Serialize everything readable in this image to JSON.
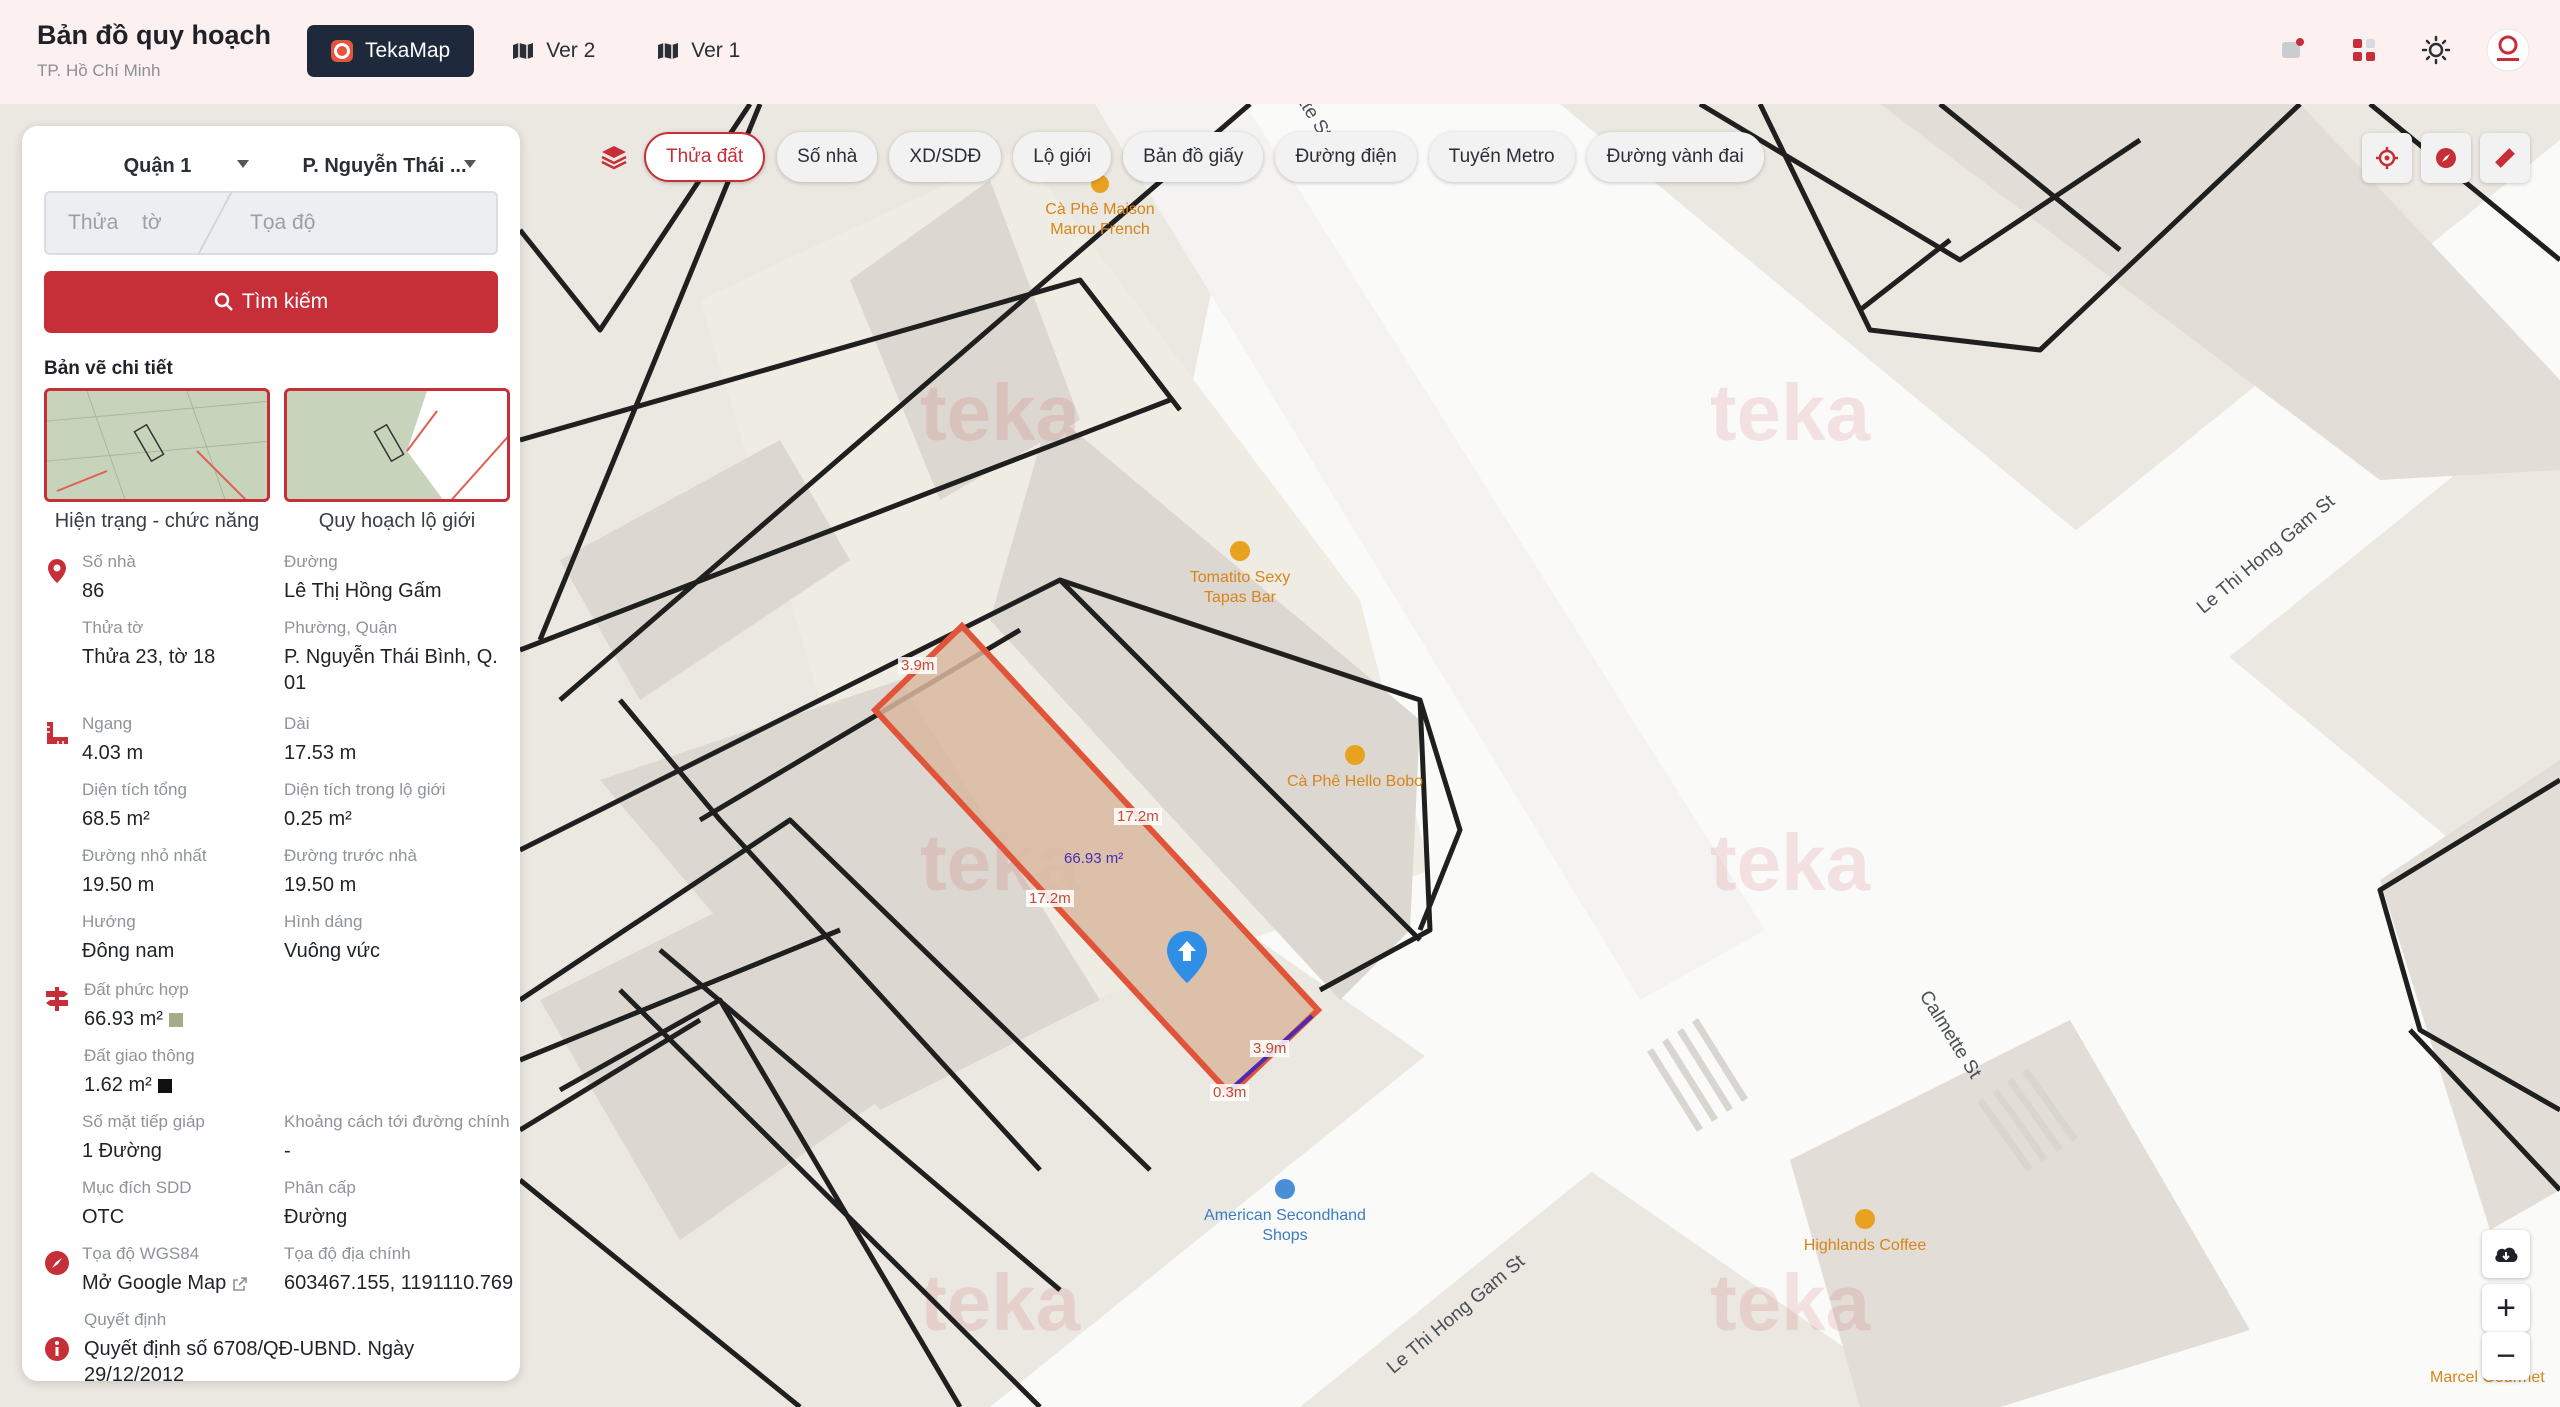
{
  "header": {
    "title": "Bản đồ quy hoạch",
    "subtitle": "TP. Hồ Chí Minh",
    "tabs": [
      {
        "label": "TekaMap"
      },
      {
        "label": "Ver 2"
      },
      {
        "label": "Ver 1"
      }
    ]
  },
  "panel": {
    "district": "Quận 1",
    "ward": "P. Nguyễn Thái ...",
    "search": {
      "thua_placeholder": "Thửa",
      "to_placeholder": "tờ",
      "coord_placeholder": "Tọa độ",
      "button": "Tìm kiếm"
    },
    "detail_title": "Bản vẽ chi tiết",
    "thumbs": [
      {
        "label": "Hiện trạng - chức năng"
      },
      {
        "label": "Quy hoạch lộ giới"
      }
    ],
    "fields": {
      "so_nha": {
        "label": "Số nhà",
        "value": "86"
      },
      "duong": {
        "label": "Đường",
        "value": "Lê Thị Hồng Gấm"
      },
      "thua_to": {
        "label": "Thửa tờ",
        "value": "Thửa 23, tờ 18"
      },
      "phuong_quan": {
        "label": "Phường, Quận",
        "value": "P. Nguyễn Thái Bình, Q. 01"
      },
      "ngang": {
        "label": "Ngang",
        "value": "4.03 m"
      },
      "dai": {
        "label": "Dài",
        "value": "17.53 m"
      },
      "dt_tong": {
        "label": "Diện tích tổng",
        "value": "68.5 m²"
      },
      "dt_lo_gioi": {
        "label": "Diện tích trong lộ giới",
        "value": "0.25 m²"
      },
      "duong_nho_nhat": {
        "label": "Đường nhỏ nhất",
        "value": "19.50 m"
      },
      "duong_truoc_nha": {
        "label": "Đường trước nhà",
        "value": "19.50 m"
      },
      "huong": {
        "label": "Hướng",
        "value": "Đông nam"
      },
      "hinh_dang": {
        "label": "Hình dáng",
        "value": "Vuông vức"
      },
      "dat_phuc_hop": {
        "label": "Đất phức hợp",
        "value": "66.93 m²"
      },
      "dat_giao_thong": {
        "label": "Đất giao thông",
        "value": "1.62 m²"
      },
      "so_mat_tiep_giap": {
        "label": "Số mặt tiếp giáp",
        "value": "1 Đường"
      },
      "khoang_cach": {
        "label": "Khoảng cách tới đường chính",
        "value": "-"
      },
      "muc_dich": {
        "label": "Mục đích SDD",
        "value": "OTC"
      },
      "phan_cap": {
        "label": "Phân cấp",
        "value": "Đường"
      },
      "wgs84": {
        "label": "Tọa độ WGS84",
        "value": "Mở Google Map"
      },
      "dia_chinh": {
        "label": "Tọa độ địa chính",
        "value": "603467.155, 1191110.769"
      },
      "quyet_dinh": {
        "label": "Quyết định",
        "value": "Quyết định số 6708/QĐ-UBND. Ngày 29/12/2012"
      }
    }
  },
  "chips": [
    "Thửa đất",
    "Số nhà",
    "XD/SDĐ",
    "Lộ giới",
    "Bản đồ giấy",
    "Đường điện",
    "Tuyến Metro",
    "Đường vành đai"
  ],
  "map": {
    "pois": [
      {
        "name": "Cà Phê Maison Marou French"
      },
      {
        "name": "Tomatito Sexy Tapas Bar"
      },
      {
        "name": "Cà Phê Hello Bobo"
      },
      {
        "name": "American Secondhand Shops"
      },
      {
        "name": "Highlands Coffee"
      },
      {
        "name": "Marcel Gourmet"
      }
    ],
    "streets": [
      "Le Thi Hong Gam St",
      "Le Thi Hong Gam St",
      "Calmette St",
      "Calmette St"
    ],
    "dimensions": [
      "3.9m",
      "17.2m",
      "17.2m",
      "3.9m",
      "0.3m"
    ],
    "area": "66.93 m²",
    "watermark": "teka"
  },
  "colors": {
    "accent": "#c62f37",
    "parcel_fill": "#d9b9a0",
    "parcel_stroke": "#e0553a",
    "dark_tab": "#1e293b"
  }
}
